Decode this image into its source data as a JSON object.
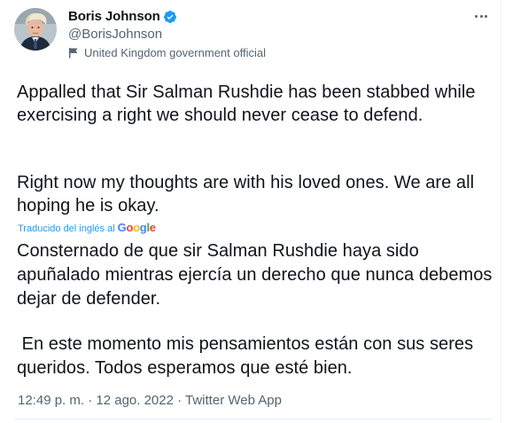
{
  "author": {
    "display_name": "Boris Johnson",
    "handle": "@BorisJohnson",
    "label": "United Kingdom government official"
  },
  "icons": {
    "verified": "verified-badge-icon",
    "label": "flag-icon",
    "more": "more-options-icon"
  },
  "colors": {
    "verified": "#1d9bf0",
    "link": "#1d9bf0",
    "secondary_text": "#536471"
  },
  "tweet": {
    "original_p1": "Appalled that Sir Salman Rushdie has been stabbed while exercising a right we should never cease to defend.",
    "original_p2": "Right now my thoughts are with his loved ones. We are all hoping he is okay.",
    "translated_by": "Traducido del inglés al",
    "translator": "Google",
    "translation_p1": "Consternado de que sir Salman Rushdie haya sido apuñalado mientras ejercía un derecho que nunca debemos dejar de defender.",
    "translation_p2": " En este momento mis pensamientos están con sus seres queridos. Todos esperamos que esté bien."
  },
  "meta": {
    "line": "12:49 p. m. · 12 ago. 2022 · Twitter Web App"
  }
}
